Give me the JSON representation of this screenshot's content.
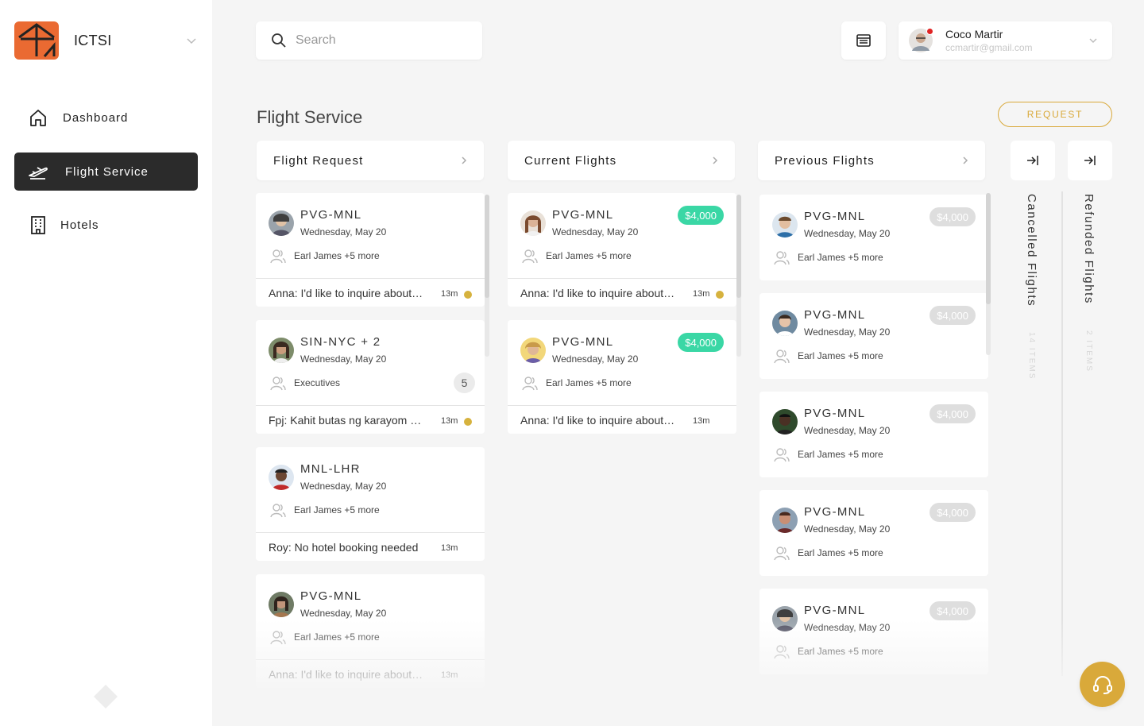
{
  "brand": {
    "name": "ICTSI"
  },
  "nav": [
    {
      "label": "Dashboard",
      "icon": "home-icon",
      "active": false
    },
    {
      "label": "Flight Service",
      "icon": "plane-icon",
      "active": true
    },
    {
      "label": "Hotels",
      "icon": "building-icon",
      "active": false
    }
  ],
  "search": {
    "placeholder": "Search",
    "value": ""
  },
  "user": {
    "name": "Coco Martir",
    "email": "ccmartir@gmail.com"
  },
  "page": {
    "title": "Flight Service",
    "request_label": "REQUEST"
  },
  "columns": {
    "flight_request": {
      "title": "Flight Request",
      "cards": [
        {
          "route": "PVG-MNL",
          "date": "Wednesday, May 20",
          "people": "Earl James +5 more",
          "message": "Anna: I'd like to inquire about the flight",
          "time": "13m",
          "unread": true
        },
        {
          "route": "SIN-NYC + 2",
          "date": "Wednesday, May 20",
          "people": "Executives",
          "count": "5",
          "message": "Fpj: Kahit butas ng karayom ay papasukin",
          "time": "13m",
          "unread": true
        },
        {
          "route": "MNL-LHR",
          "date": "Wednesday, May 20",
          "people": "Earl James +5 more",
          "message": "Roy: No hotel booking needed",
          "time": "13m",
          "unread": false
        },
        {
          "route": "PVG-MNL",
          "date": "Wednesday, May 20",
          "people": "Earl James +5 more",
          "message": "Anna: I'd like to inquire about the flight",
          "time": "13m",
          "unread": false
        }
      ]
    },
    "current_flights": {
      "title": "Current Flights",
      "cards": [
        {
          "route": "PVG-MNL",
          "date": "Wednesday, May 20",
          "people": "Earl James +5 more",
          "price": "$4,000",
          "message": "Anna: I'd like to inquire about the flight",
          "time": "13m",
          "unread": true
        },
        {
          "route": "PVG-MNL",
          "date": "Wednesday, May 20",
          "people": "Earl James +5 more",
          "price": "$4,000",
          "message": "Anna: I'd like to inquire about the flight",
          "time": "13m",
          "unread": false
        }
      ]
    },
    "previous_flights": {
      "title": "Previous Flights",
      "cards": [
        {
          "route": "PVG-MNL",
          "date": "Wednesday, May 20",
          "people": "Earl James +5 more",
          "price": "$4,000"
        },
        {
          "route": "PVG-MNL",
          "date": "Wednesday, May 20",
          "people": "Earl James +5 more",
          "price": "$4,000"
        },
        {
          "route": "PVG-MNL",
          "date": "Wednesday, May 20",
          "people": "Earl James +5 more",
          "price": "$4,000"
        },
        {
          "route": "PVG-MNL",
          "date": "Wednesday, May 20",
          "people": "Earl James +5 more",
          "price": "$4,000"
        },
        {
          "route": "PVG-MNL",
          "date": "Wednesday, May 20",
          "people": "Earl James +5 more",
          "price": "$4,000"
        }
      ]
    },
    "cancelled": {
      "title": "Cancelled Flights",
      "count": "14 ITEMS"
    },
    "refunded": {
      "title": "Refunded Flights",
      "count": "2 ITEMS"
    }
  },
  "colors": {
    "accent": "#d9a93a",
    "brand": "#ea6a32",
    "price_active": "#3ad7a5",
    "nav_active": "#2b2b2b"
  }
}
